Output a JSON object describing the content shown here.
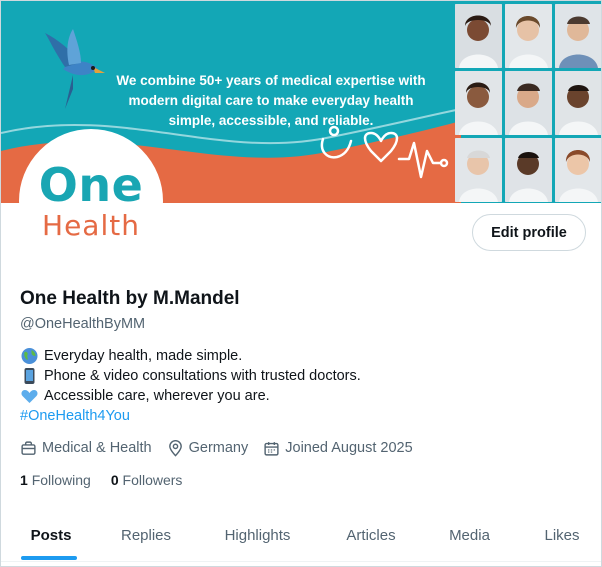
{
  "banner": {
    "tagline_lines": [
      "We combine 50+ years of medical expertise with",
      "modern digital care to make everyday health",
      "simple, accessible, and reliable."
    ],
    "colors": {
      "teal": "#13a7b6",
      "orange": "#e56a44"
    }
  },
  "avatar": {
    "logo_line1": "One",
    "logo_line2": "Health"
  },
  "edit_profile": "Edit profile",
  "profile": {
    "display_name": "One Health by M.Mandel",
    "handle": "@OneHealthByMM",
    "bio": {
      "line1": "Everyday health, made simple.",
      "line1_icon": "globe-emoji",
      "line2": "Phone & video consultations with trusted doctors.",
      "line2_icon": "mobile-phone-emoji",
      "line3": "Accessible care, wherever you are.",
      "line3_icon": "blue-heart-emoji",
      "hashtag": "#OneHealth4You"
    },
    "meta": {
      "category": "Medical & Health",
      "location": "Germany",
      "joined": "Joined August 2025"
    },
    "following_count": "1",
    "following_label": "Following",
    "followers_count": "0",
    "followers_label": "Followers"
  },
  "tabs": [
    "Posts",
    "Replies",
    "Highlights",
    "Articles",
    "Media",
    "Likes"
  ],
  "active_tab": "Posts",
  "accent": "#1d9bf0"
}
